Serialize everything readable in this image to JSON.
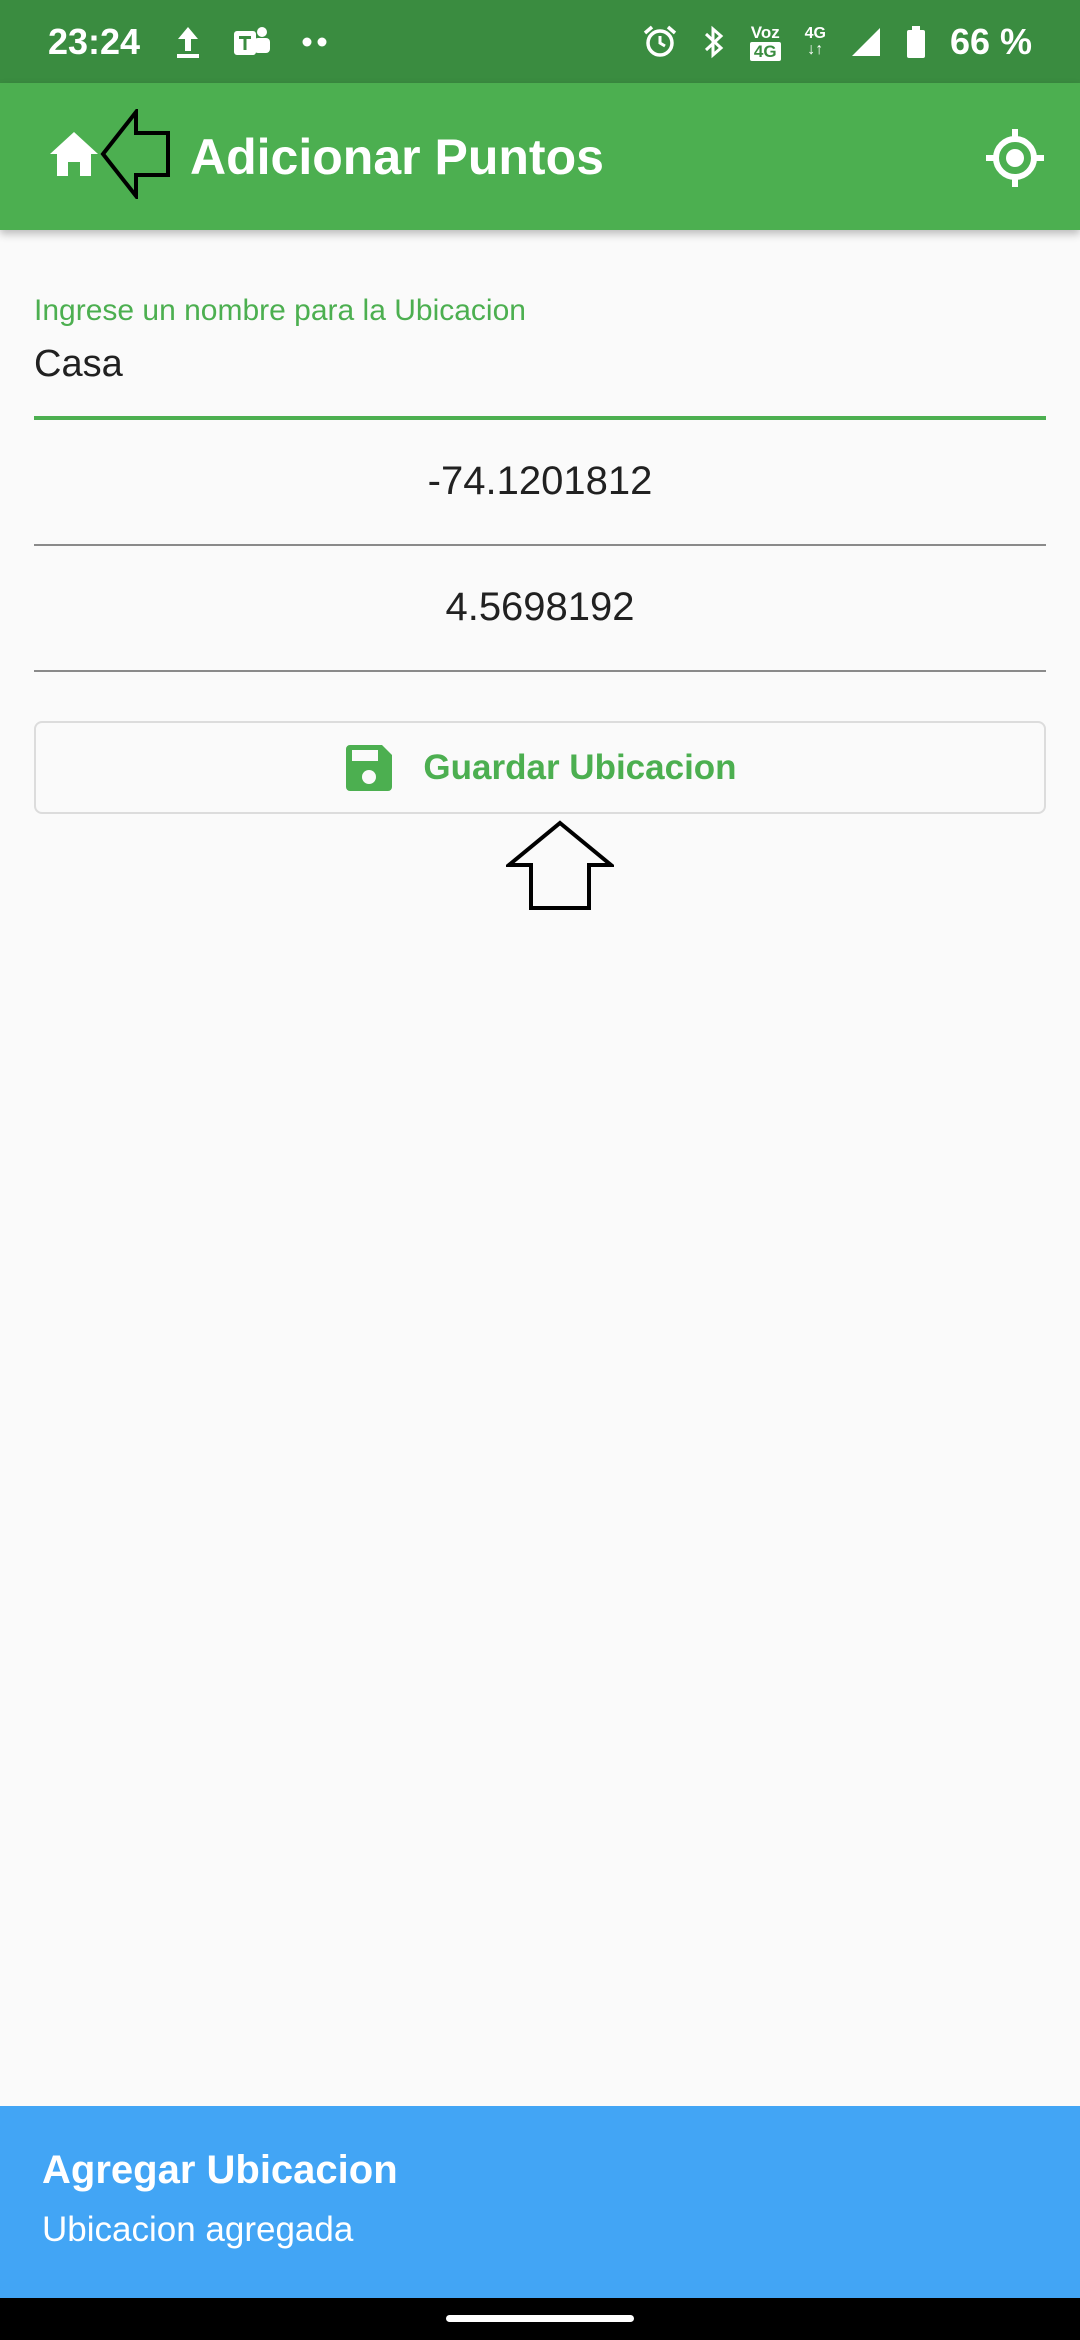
{
  "status_bar": {
    "time": "23:24",
    "battery_text": "66 %",
    "network_label": "4G",
    "voz_label": "Voz",
    "voz_sub": "4G",
    "icons": [
      "upload-icon",
      "teams-icon",
      "more-dots-icon",
      "alarm-icon",
      "bluetooth-icon",
      "signal-icon",
      "battery-icon"
    ]
  },
  "app_bar": {
    "title": "Adicionar Puntos",
    "color": "#4caf50"
  },
  "form": {
    "name_label": "Ingrese un nombre para la Ubicacion",
    "name_value": "Casa",
    "longitude_value": "-74.1201812",
    "latitude_value": "4.5698192",
    "save_label": "Guardar Ubicacion"
  },
  "snackbar": {
    "title": "Agregar Ubicacion",
    "message": "Ubicacion agregada",
    "color": "#42a5f5"
  }
}
